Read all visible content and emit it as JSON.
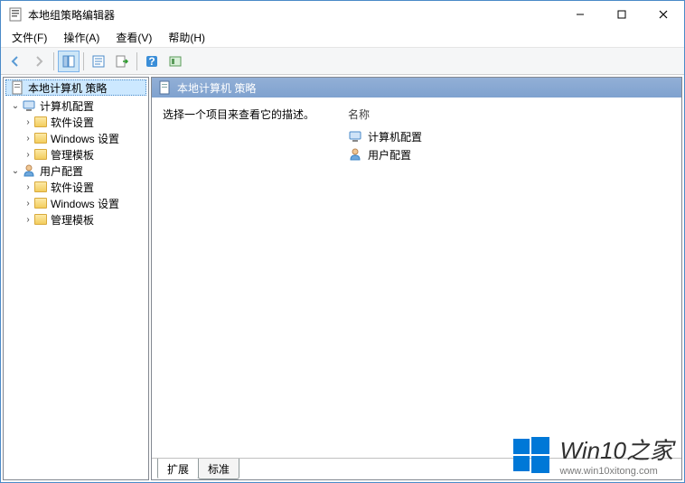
{
  "window": {
    "title": "本地组策略编辑器"
  },
  "menu": {
    "file": "文件(F)",
    "action": "操作(A)",
    "view": "查看(V)",
    "help": "帮助(H)"
  },
  "tree": {
    "root": "本地计算机 策略",
    "computer": "计算机配置",
    "user": "用户配置",
    "software": "软件设置",
    "windows": "Windows 设置",
    "templates": "管理模板"
  },
  "detail": {
    "header": "本地计算机 策略",
    "description": "选择一个项目来查看它的描述。",
    "colName": "名称",
    "items": {
      "computer": "计算机配置",
      "user": "用户配置"
    }
  },
  "tabs": {
    "extended": "扩展",
    "standard": "标准"
  },
  "watermark": {
    "brand": "Win10之家",
    "url": "www.win10xitong.com"
  }
}
